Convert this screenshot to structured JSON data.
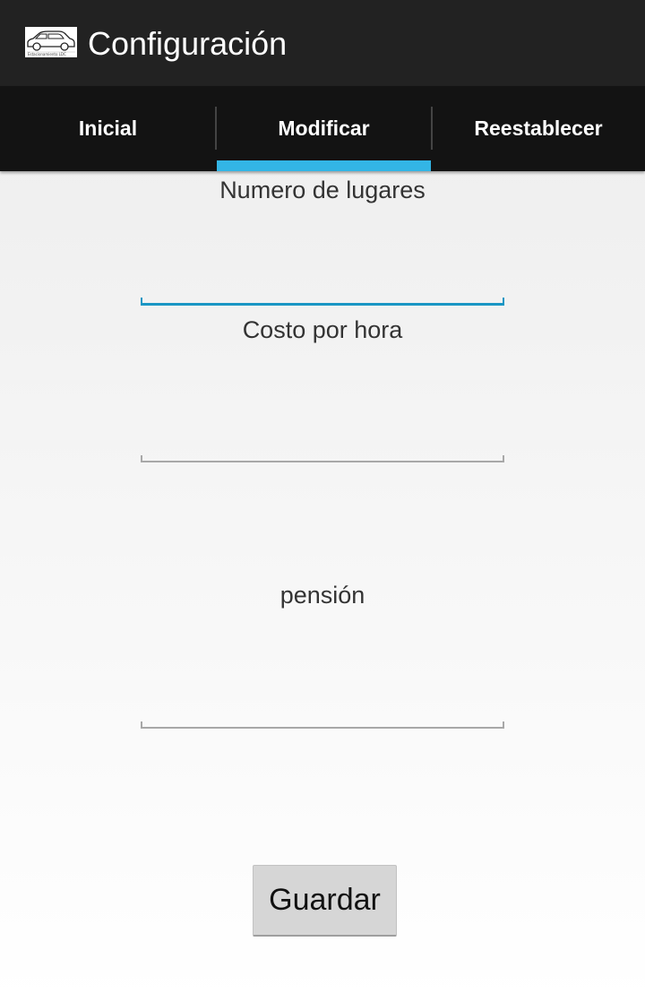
{
  "action_bar": {
    "title": "Configuración",
    "icon": "car-logo-icon",
    "icon_caption": "Estacionamiento LDC"
  },
  "tabs": [
    {
      "label": "Inicial",
      "selected": false
    },
    {
      "label": "Modificar",
      "selected": true
    },
    {
      "label": "Reestablecer",
      "selected": false
    }
  ],
  "form": {
    "fields": [
      {
        "label": "Numero de lugares",
        "value": "",
        "focused": true
      },
      {
        "label": "Costo por hora",
        "value": "",
        "focused": false
      },
      {
        "label": "pensión",
        "value": "",
        "focused": false
      }
    ],
    "save_label": "Guardar"
  },
  "colors": {
    "action_bar_bg": "#222222",
    "tab_bar_bg": "#131313",
    "tab_indicator": "#33b5e5",
    "focused_underline": "#1a96c4",
    "unfocused_underline": "#a8a8a8",
    "button_bg": "#d6d6d6"
  }
}
